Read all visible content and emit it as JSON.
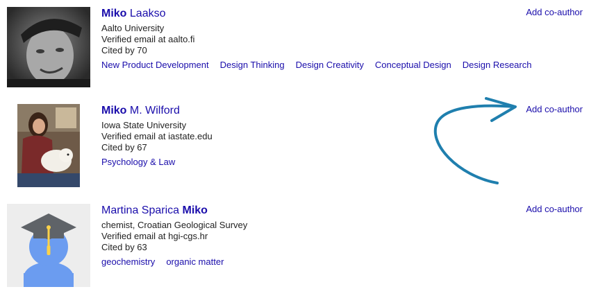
{
  "authors": [
    {
      "name_match": "Miko",
      "name_rest": " Laakso",
      "affiliation": "Aalto University",
      "email": "Verified email at aalto.fi",
      "cited": "Cited by 70",
      "interests": [
        "New Product Development",
        "Design Thinking",
        "Design Creativity",
        "Conceptual Design",
        "Design Research"
      ],
      "add_label": "Add co-author",
      "photo_icon": "portrait-photo"
    },
    {
      "name_match": "Miko",
      "name_rest": " M. Wilford",
      "affiliation": "Iowa State University",
      "email": "Verified email at iastate.edu",
      "cited": "Cited by 67",
      "interests": [
        "Psychology & Law"
      ],
      "add_label": "Add co-author",
      "photo_icon": "portrait-photo"
    },
    {
      "name_pre": "Martina Sparica ",
      "name_match": "Miko",
      "affiliation": "chemist, Croatian Geological Survey",
      "email": "Verified email at hgi-cgs.hr",
      "cited": "Cited by 63",
      "interests": [
        "geochemistry",
        "organic matter"
      ],
      "add_label": "Add co-author",
      "photo_icon": "default-scholar-avatar-icon"
    }
  ],
  "colors": {
    "link": "#1a0dab",
    "arrow": "#1f7fae",
    "avatar_body": "#6b9cf0",
    "avatar_cap": "#5f6368",
    "tassel": "#fbd24a"
  }
}
